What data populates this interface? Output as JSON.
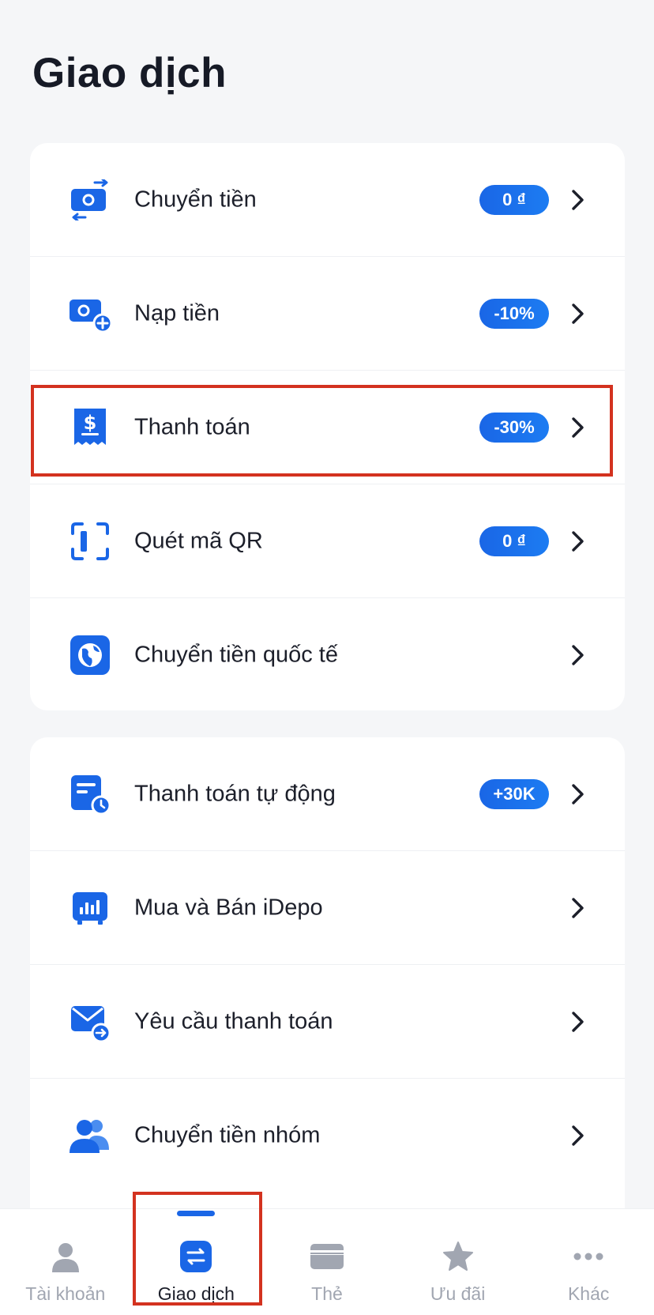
{
  "page": {
    "title": "Giao dịch"
  },
  "colors": {
    "accent": "#1a66e6",
    "highlight": "#d3321f",
    "inactive": "#a1a6b1"
  },
  "group1": [
    {
      "label": "Chuyển tiền",
      "badge": "0 ₫",
      "icon": "money-transfer-icon"
    },
    {
      "label": "Nạp tiền",
      "badge": "-10%",
      "icon": "top-up-icon"
    },
    {
      "label": "Thanh toán",
      "badge": "-30%",
      "icon": "bill-payment-icon"
    },
    {
      "label": "Quét mã QR",
      "badge": "0 ₫",
      "icon": "qr-scan-icon"
    },
    {
      "label": "Chuyển tiền quốc tế",
      "badge": "",
      "icon": "globe-icon"
    }
  ],
  "group2": [
    {
      "label": "Thanh toán tự động",
      "badge": "+30K",
      "icon": "auto-payment-icon"
    },
    {
      "label": "Mua và Bán iDepo",
      "badge": "",
      "icon": "idepo-icon"
    },
    {
      "label": "Yêu cầu thanh toán",
      "badge": "",
      "icon": "payment-request-icon"
    },
    {
      "label": "Chuyển tiền nhóm",
      "badge": "",
      "icon": "group-transfer-icon"
    }
  ],
  "nav": [
    {
      "label": "Tài khoản",
      "icon": "person-icon"
    },
    {
      "label": "Giao dịch",
      "icon": "transaction-icon",
      "active": true
    },
    {
      "label": "Thẻ",
      "icon": "card-icon"
    },
    {
      "label": "Ưu đãi",
      "icon": "star-icon"
    },
    {
      "label": "Khác",
      "icon": "more-icon"
    }
  ]
}
